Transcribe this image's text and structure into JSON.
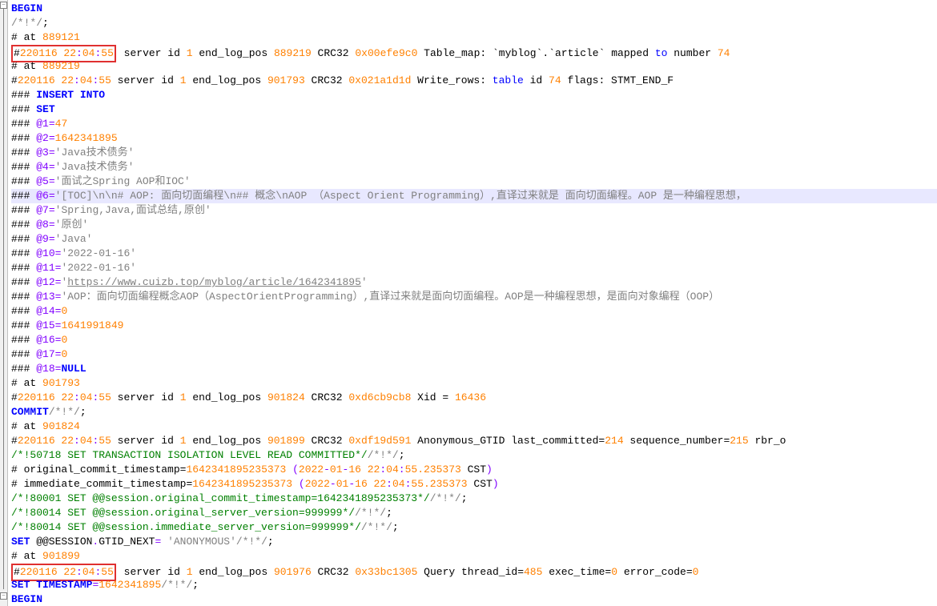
{
  "lines": {
    "l1": {
      "begin": "BEGIN"
    },
    "l2": {
      "comment": "/*!*/",
      "semi": ";"
    },
    "l3": {
      "hash": "#",
      "at": " at ",
      "pos": "889121"
    },
    "l4": {
      "prefix": "#",
      "ts": "220116 22",
      "colon1": ":",
      "m": "04",
      "colon2": ":",
      "s": "55",
      "srv": " server id ",
      "sid": "1",
      "elp": "   end_log_pos ",
      "pos": "889219",
      "crc": " CRC32 ",
      "hex": "0x00efe9c0",
      "tm": "   Table_map: `myblog`.`article` mapped ",
      "to": "to",
      "num": " number ",
      "n": "74"
    },
    "l5": {
      "hash": "#",
      "at": " at ",
      "pos": "889219"
    },
    "l6": {
      "prefix": "#",
      "ts": "220116 22",
      "colon1": ":",
      "m": "04",
      "colon2": ":",
      "s": "55",
      "srv": " server id ",
      "sid": "1",
      "elp": "   end_log_pos ",
      "pos": "901793",
      "crc": " CRC32 ",
      "hex": "0x021a1d1d",
      "wr": "   Write_rows: ",
      "tbl": "table",
      "id": " id ",
      "tid": "74",
      "flags": " flags: STMT_END_F"
    },
    "l7": {
      "hash": "###  ",
      "ins": "INSERT",
      "sp": " ",
      "into": "INTO",
      "blur": "                  "
    },
    "l8": {
      "hash": "###  ",
      "set": "SET"
    },
    "l9": {
      "hash": "###   ",
      "at": "@1",
      "eq": "=",
      "val": "47"
    },
    "l10": {
      "hash": "###   ",
      "at": "@2",
      "eq": "=",
      "val": "1642341895"
    },
    "l11": {
      "hash": "###   ",
      "at": "@3",
      "eq": "=",
      "val": "'Java技术债务'"
    },
    "l12": {
      "hash": "###   ",
      "at": "@4",
      "eq": "=",
      "val": "'Java技术债务'"
    },
    "l13": {
      "hash": "###   ",
      "at": "@5",
      "eq": "=",
      "val": "'面试之Spring AOP和IOC'"
    },
    "l14": {
      "hash": "###   ",
      "at": "@6",
      "eq": "=",
      "val": "'[TOC]\\n\\n# AOP:  面向切面编程\\n## 概念\\nAOP （Aspect Orient Programming）,直译过来就是 面向切面编程。AOP 是一种编程思想，"
    },
    "l15": {
      "hash": "###   ",
      "at": "@7",
      "eq": "=",
      "val": "'Spring,Java,面试总结,原创'"
    },
    "l16": {
      "hash": "###   ",
      "at": "@8",
      "eq": "=",
      "val": "'原创'"
    },
    "l17": {
      "hash": "###   ",
      "at": "@9",
      "eq": "=",
      "val": "'Java'"
    },
    "l18": {
      "hash": "###   ",
      "at": "@10",
      "eq": "=",
      "val": "'2022-01-16'"
    },
    "l19": {
      "hash": "###   ",
      "at": "@11",
      "eq": "=",
      "val": "'2022-01-16'"
    },
    "l20": {
      "hash": "###   ",
      "at": "@12",
      "eq": "=",
      "q1": "'",
      "url": "https://www.cuizb.top/myblog/article/1642341895",
      "q2": "'"
    },
    "l21": {
      "hash": "###   ",
      "at": "@13",
      "eq": "=",
      "val": "'AOP：面向切面编程概念AOP（AspectOrientProgramming）,直译过来就是面向切面编程。AOP是一种编程思想，是面向对象编程（OOP）"
    },
    "l22": {
      "hash": "###   ",
      "at": "@14",
      "eq": "=",
      "val": "0"
    },
    "l23": {
      "hash": "###   ",
      "at": "@15",
      "eq": "=",
      "val": "1641991849"
    },
    "l24": {
      "hash": "###   ",
      "at": "@16",
      "eq": "=",
      "val": "0"
    },
    "l25": {
      "hash": "###   ",
      "at": "@17",
      "eq": "=",
      "val": "0"
    },
    "l26": {
      "hash": "###   ",
      "at": "@18",
      "eq": "=",
      "val": "NULL"
    },
    "l27": {
      "hash": "#",
      "at": " at ",
      "pos": "901793"
    },
    "l28": {
      "prefix": "#",
      "ts": "220116 22",
      "colon1": ":",
      "m": "04",
      "colon2": ":",
      "s": "55",
      "srv": " server id ",
      "sid": "1",
      "elp": "   end_log_pos ",
      "pos": "901824",
      "crc": " CRC32 ",
      "hex": "0xd6cb9cb8",
      "xid": "   Xid = ",
      "xv": "16436"
    },
    "l29": {
      "commit": "COMMIT",
      "cmt": "/*!*/",
      "semi": ";"
    },
    "l30": {
      "hash": "#",
      "at": " at ",
      "pos": "901824"
    },
    "l31": {
      "prefix": "#",
      "ts": "220116 22",
      "colon1": ":",
      "m": "04",
      "colon2": ":",
      "s": "55",
      "srv": " server id ",
      "sid": "1",
      "elp": "   end_log_pos ",
      "pos": "901899",
      "crc": " CRC32 ",
      "hex": "0xdf19d591",
      "ag": "   Anonymous_GTID  last_committed=",
      "lc": "214",
      "sn": "  sequence_number=",
      "snv": "215",
      "rbr": " rbr_o"
    },
    "l32": {
      "cmt": "/*!50718 SET TRANSACTION ISOLATION LEVEL READ COMMITTED*/",
      "cmt2": "/*!*/",
      "semi": ";"
    },
    "l33": {
      "hash": "#",
      "o": " original_commit_timestamp=",
      "ts": "1642341895235373",
      "p1": " (",
      "d1": "2022",
      "dash1": "-",
      "d2": "01",
      "dash2": "-",
      "d3": "16 22",
      "c1": ":",
      "d4": "04",
      "c2": ":",
      "d5": "55.235373",
      "tz": " CST",
      "p2": ")"
    },
    "l34": {
      "hash": "#",
      "o": " immediate_commit_timestamp=",
      "ts": "1642341895235373",
      "p1": " (",
      "d1": "2022",
      "dash1": "-",
      "d2": "01",
      "dash2": "-",
      "d3": "16 22",
      "c1": ":",
      "d4": "04",
      "c2": ":",
      "d5": "55.235373",
      "tz": " CST",
      "p2": ")"
    },
    "l35": {
      "cmt": "/*!80001 SET @@session.original_commit_timestamp=1642341895235373*/",
      "cmt2": "/*!*/",
      "semi": ";"
    },
    "l36": {
      "cmt": "/*!80014 SET @@session.original_server_version=999999*/",
      "cmt2": "/*!*/",
      "semi": ";"
    },
    "l37": {
      "cmt": "/*!80014 SET @@session.immediate_server_version=999999*/",
      "cmt2": "/*!*/",
      "semi": ";"
    },
    "l38": {
      "set": "SET",
      "ss": " @@SESSION",
      "dot": ".",
      "gn": "GTID_NEXT",
      "eq": "= ",
      "val": "'ANONYMOUS'",
      "cmt": "/*!*/",
      "semi": ";"
    },
    "l39": {
      "hash": "#",
      "at": " at ",
      "pos": "901899"
    },
    "l40": {
      "prefix": "#",
      "ts": "220116 22",
      "colon1": ":",
      "m": "04",
      "colon2": ":",
      "s": "55",
      "srv": " server id ",
      "sid": "1",
      "elp": "   end_log_pos ",
      "pos": "901976",
      "crc": " CRC32 ",
      "hex": "0x33bc1305",
      "q": "   Query   thread_id=",
      "tid": "485",
      "et": "   exec_time=",
      "etv": "0",
      "ec": " error_code=",
      "ecv": "0"
    },
    "l41": {
      "set": "SET",
      "sp": " ",
      "ts": "TIMESTAMP",
      "eq": "=",
      "val": "1642341895",
      "cmt": "/*!*/",
      "semi": ";"
    },
    "l42": {
      "begin": "BEGIN"
    }
  }
}
